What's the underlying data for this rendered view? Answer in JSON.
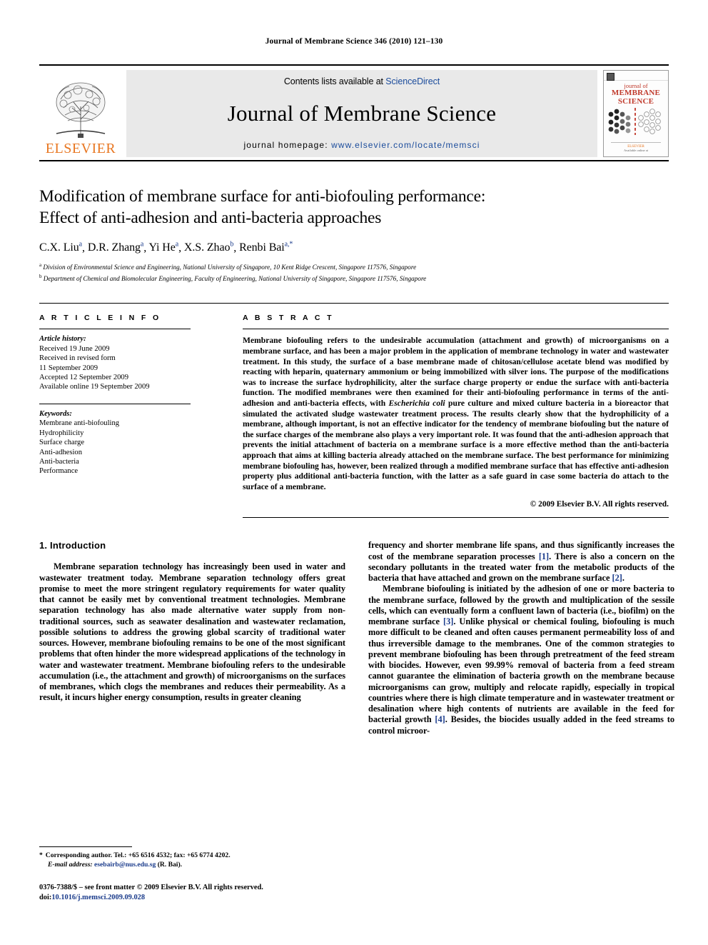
{
  "running_head": "Journal of Membrane Science 346 (2010) 121–130",
  "masthead": {
    "publisher_name": "ELSEVIER",
    "contents_prefix": "Contents lists available at ",
    "contents_link": "ScienceDirect",
    "journal_title": "Journal of Membrane Science",
    "homepage_label": "journal homepage: ",
    "homepage_url": "www.elsevier.com/locate/memsci",
    "cover": {
      "line1": "journal of",
      "line2": "MEMBRANE",
      "line3": "SCIENCE",
      "footer_line1": "ELSEVIER",
      "footer_line2": "Available online at"
    }
  },
  "article": {
    "title_line1": "Modification of membrane surface for anti-biofouling performance:",
    "title_line2": "Effect of anti-adhesion and anti-bacteria approaches",
    "authors": [
      {
        "name": "C.X. Liu",
        "sup": "a"
      },
      {
        "name": "D.R. Zhang",
        "sup": "a"
      },
      {
        "name": "Yi He",
        "sup": "a"
      },
      {
        "name": "X.S. Zhao",
        "sup": "b"
      },
      {
        "name": "Renbi Bai",
        "sup": "a,*"
      }
    ],
    "affiliations": [
      {
        "marker": "a",
        "text": "Division of Environmental Science and Engineering, National University of Singapore, 10 Kent Ridge Crescent, Singapore 117576, Singapore"
      },
      {
        "marker": "b",
        "text": "Department of Chemical and Biomolecular Engineering, Faculty of Engineering, National University of Singapore, Singapore 117576, Singapore"
      }
    ]
  },
  "article_info": {
    "heading": "A R T I C L E  I N F O",
    "history_label": "Article history:",
    "history": [
      "Received 19 June 2009",
      "Received in revised form",
      "11 September 2009",
      "Accepted 12 September 2009",
      "Available online 19 September 2009"
    ],
    "keywords_label": "Keywords:",
    "keywords": [
      "Membrane anti-biofouling",
      "Hydrophilicity",
      "Surface charge",
      "Anti-adhesion",
      "Anti-bacteria",
      "Performance"
    ]
  },
  "abstract": {
    "heading": "A B S T R A C T",
    "text_part1": "Membrane biofouling refers to the undesirable accumulation (attachment and growth) of microorganisms on a membrane surface, and has been a major problem in the application of membrane technology in water and wastewater treatment. In this study, the surface of a base membrane made of chitosan/cellulose acetate blend was modified by reacting with heparin, quaternary ammonium or being immobilized with silver ions. The purpose of the modifications was to increase the surface hydrophilicity, alter the surface charge property or endue the surface with anti-bacteria function. The modified membranes were then examined for their anti-biofouling performance in terms of the anti-adhesion and anti-bacteria effects, with ",
    "italic_species": "Escherichia coli",
    "text_part2": " pure culture and mixed culture bacteria in a bioreactor that simulated the activated sludge wastewater treatment process. The results clearly show that the hydrophilicity of a membrane, although important, is not an effective indicator for the tendency of membrane biofouling but the nature of the surface charges of the membrane also plays a very important role. It was found that the anti-adhesion approach that prevents the initial attachment of bacteria on a membrane surface is a more effective method than the anti-bacteria approach that aims at killing bacteria already attached on the membrane surface. The best performance for minimizing membrane biofouling has, however, been realized through a modified membrane surface that has effective anti-adhesion property plus additional anti-bacteria function, with the latter as a safe guard in case some bacteria do attach to the surface of a membrane.",
    "copyright": "© 2009 Elsevier B.V. All rights reserved."
  },
  "introduction": {
    "heading": "1. Introduction",
    "left_para1": "Membrane separation technology has increasingly been used in water and wastewater treatment today. Membrane separation technology offers great promise to meet the more stringent regulatory requirements for water quality that cannot be easily met by conventional treatment technologies. Membrane separation technology has also made alternative water supply from non-traditional sources, such as seawater desalination and wastewater reclamation, possible solutions to address the growing global scarcity of traditional water sources. However, membrane biofouling remains to be one of the most significant problems that often hinder the more widespread applications of the technology in water and wastewater treatment. Membrane biofouling refers to the undesirable accumulation (i.e., the attachment and growth) of microorganisms on the surfaces of membranes, which clogs the membranes and reduces their permeability. As a result, it incurs higher energy consumption, results in greater cleaning",
    "right_para1_a": "frequency and shorter membrane life spans, and thus significantly increases the cost of the membrane separation processes ",
    "right_cite1": "[1]",
    "right_para1_b": ". There is also a concern on the secondary pollutants in the treated water from the metabolic products of the bacteria that have attached and grown on the membrane surface ",
    "right_cite2": "[2]",
    "right_para1_c": ".",
    "right_para2_a": "Membrane biofouling is initiated by the adhesion of one or more bacteria to the membrane surface, followed by the growth and multiplication of the sessile cells, which can eventually form a confluent lawn of bacteria (i.e., biofilm) on the membrane surface ",
    "right_cite3": "[3]",
    "right_para2_b": ". Unlike physical or chemical fouling, biofouling is much more difficult to be cleaned and often causes permanent permeability loss of and thus irreversible damage to the membranes. One of the common strategies to prevent membrane biofouling has been through pretreatment of the feed stream with biocides. However, even 99.99% removal of bacteria from a feed stream cannot guarantee the elimination of bacteria growth on the membrane because microorganisms can grow, multiply and relocate rapidly, especially in tropical countries where there is high climate temperature and in wastewater treatment or desalination where high contents of nutrients are available in the feed for bacterial growth ",
    "right_cite4": "[4]",
    "right_para2_c": ". Besides, the biocides usually added in the feed streams to control microor-"
  },
  "footer": {
    "corresponding_star": "*",
    "corresponding_text": "Corresponding author. Tel.: +65 6516 4532; fax: +65 6774 4202.",
    "email_label": "E-mail address:",
    "email": "esebairb@nus.edu.sg",
    "email_owner": "(R. Bai).",
    "issn_line": "0376-7388/$ – see front matter © 2009 Elsevier B.V. All rights reserved.",
    "doi_label": "doi:",
    "doi_value": "10.1016/j.memsci.2009.09.028"
  },
  "colors": {
    "link_blue": "#1a3b8b",
    "elsevier_orange": "#E87722",
    "cover_red": "#c0392b",
    "banner_gray": "#e9e9e9"
  }
}
